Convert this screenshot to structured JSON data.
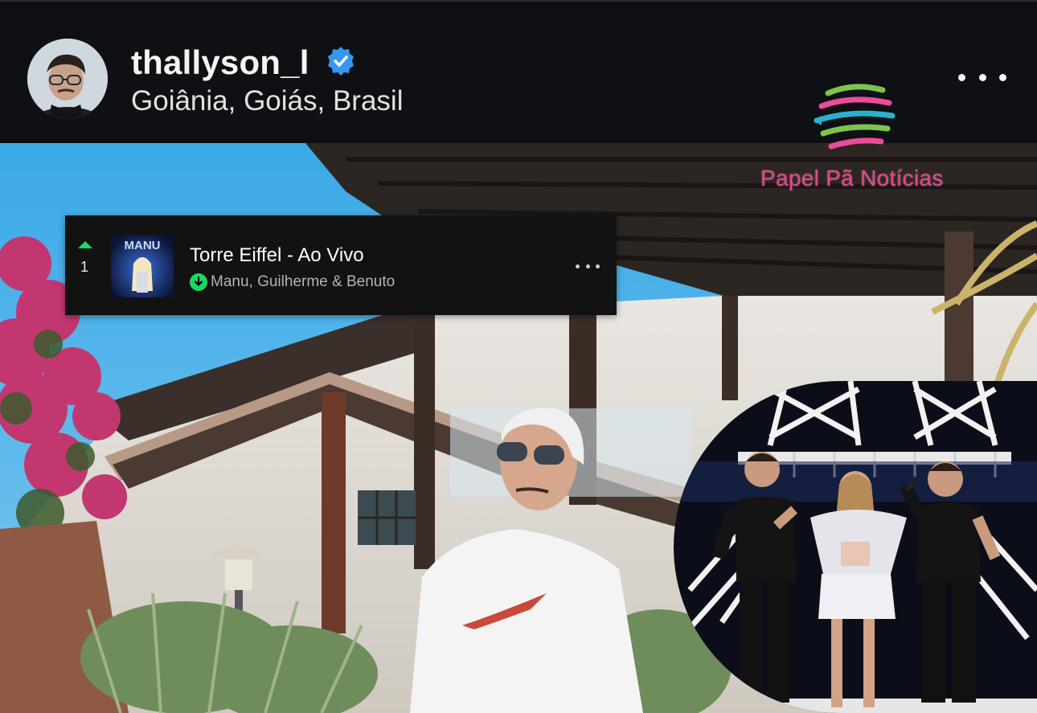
{
  "post": {
    "username": "thallyson_l",
    "location": "Goiânia, Goiás, Brasil"
  },
  "watermark": {
    "text": "Papel Pã Notícias"
  },
  "track": {
    "rank": "1",
    "title": "Torre Eiffel - Ao Vivo",
    "artists": "Manu, Guilherme & Benuto",
    "cover_text": "MANU"
  },
  "colors": {
    "verified": "#3797f0",
    "spotify_green": "#1ed760",
    "watermark_pink": "#e8458f"
  },
  "icons": [
    "verified-badge-icon",
    "more-options-icon",
    "rank-up-icon",
    "downloaded-icon"
  ]
}
